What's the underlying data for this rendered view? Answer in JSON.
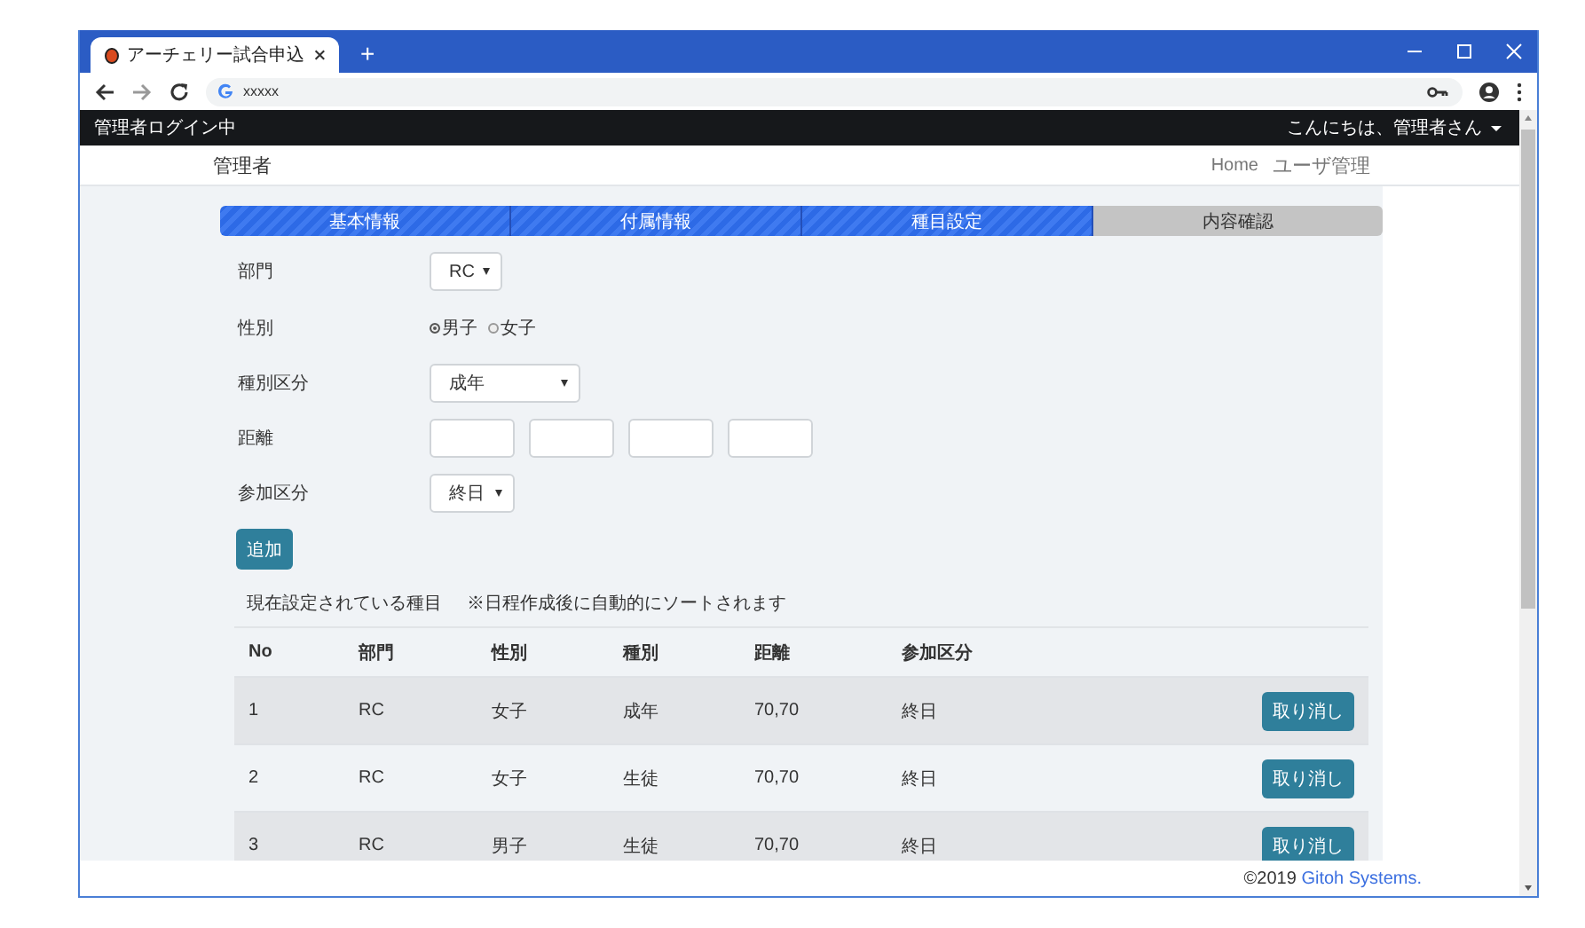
{
  "browser": {
    "tab_title": "アーチェリー試合申込",
    "new_tab": "+",
    "url": "xxxxx"
  },
  "navbar": {
    "status": "管理者ログイン中",
    "user_menu": "こんにちは、管理者さん"
  },
  "header": {
    "brand": "管理者",
    "links": [
      "Home",
      "ユーザ管理"
    ]
  },
  "steps": [
    {
      "label": "基本情報",
      "completed": true
    },
    {
      "label": "付属情報",
      "completed": true
    },
    {
      "label": "種目設定",
      "completed": true
    },
    {
      "label": "内容確認",
      "completed": false
    }
  ],
  "form": {
    "division": {
      "label": "部門",
      "value": "RC"
    },
    "gender": {
      "label": "性別",
      "options": [
        {
          "label": "男子",
          "selected": true
        },
        {
          "label": "女子",
          "selected": false
        }
      ]
    },
    "category": {
      "label": "種別区分",
      "value": "成年"
    },
    "distance": {
      "label": "距離"
    },
    "participation": {
      "label": "参加区分",
      "value": "終日"
    },
    "add_button": "追加"
  },
  "table": {
    "caption": "現在設定されている種目",
    "note": "※日程作成後に自動的にソートされます",
    "columns": [
      "No",
      "部門",
      "性別",
      "種別",
      "距離",
      "参加区分"
    ],
    "rows": [
      {
        "cells": [
          "1",
          "RC",
          "女子",
          "成年",
          "70,70",
          "終日"
        ],
        "action": "取り消し"
      },
      {
        "cells": [
          "2",
          "RC",
          "女子",
          "生徒",
          "70,70",
          "終日"
        ],
        "action": "取り消し"
      },
      {
        "cells": [
          "3",
          "RC",
          "男子",
          "生徒",
          "70,70",
          "終日"
        ],
        "action": "取り消し"
      }
    ]
  },
  "footer": {
    "text": "©2019",
    "link": "Gitoh Systems."
  }
}
